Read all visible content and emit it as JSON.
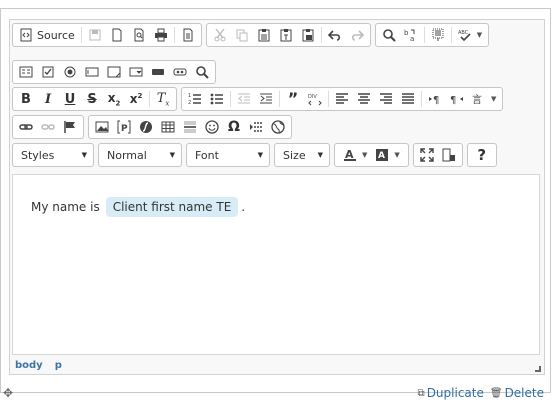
{
  "toolbar": {
    "source_label": "Source",
    "styles_label": "Styles",
    "format_label": "Normal",
    "font_label": "Font",
    "size_label": "Size",
    "help_label": "?"
  },
  "content": {
    "text_before": "My name is",
    "placeholder": "Client first name TE",
    "text_after": "."
  },
  "statusbar": {
    "path": [
      "body",
      "p"
    ]
  },
  "footer": {
    "duplicate_label": "Duplicate",
    "delete_label": "Delete"
  },
  "colors": {
    "chip_bg": "#d8ecf8",
    "link": "#2f6ea3",
    "path": "#3b73a8"
  }
}
